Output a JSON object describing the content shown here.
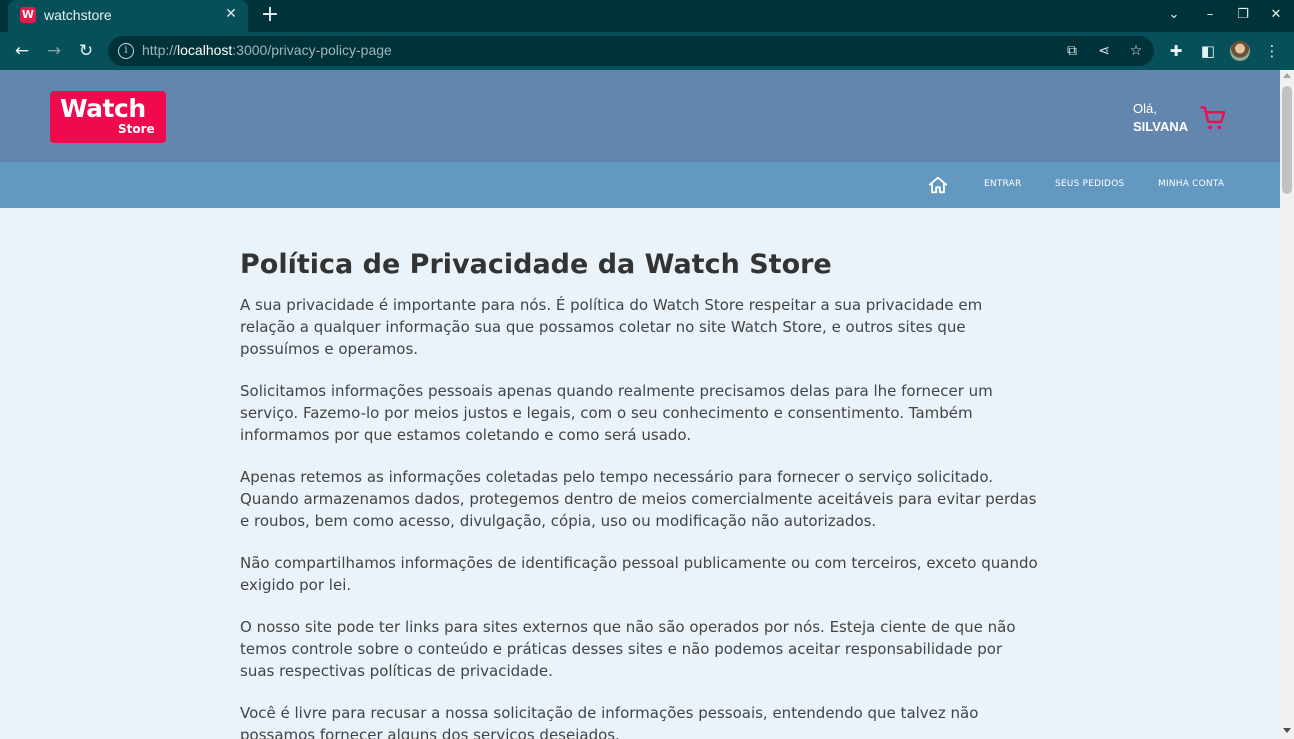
{
  "browser": {
    "tab_title": "watchstore",
    "favicon_letter": "W",
    "url_scheme": "http://",
    "url_host": "localhost",
    "url_path": ":3000/privacy-policy-page"
  },
  "header": {
    "logo_line1": "Watch",
    "logo_line2": "Store",
    "greeting": "Olá,",
    "user_name": "SILVANA",
    "brand_color": "#f1094e"
  },
  "nav": {
    "links": [
      "ENTRAR",
      "SEUS PEDIDOS",
      "MINHA CONTA"
    ]
  },
  "main": {
    "title": "Política de Privacidade da Watch Store",
    "paragraphs": [
      "A sua privacidade é importante para nós. É política do Watch Store respeitar a sua privacidade em relação a qualquer informação sua que possamos coletar no site Watch Store, e outros sites que possuímos e operamos.",
      "Solicitamos informações pessoais apenas quando realmente precisamos delas para lhe fornecer um serviço. Fazemo-lo por meios justos e legais, com o seu conhecimento e consentimento. Também informamos por que estamos coletando e como será usado.",
      "Apenas retemos as informações coletadas pelo tempo necessário para fornecer o serviço solicitado. Quando armazenamos dados, protegemos dentro de meios comercialmente aceitáveis para evitar perdas e roubos, bem como acesso, divulgação, cópia, uso ou modificação não autorizados.",
      "Não compartilhamos informações de identificação pessoal publicamente ou com terceiros, exceto quando exigido por lei.",
      "O nosso site pode ter links para sites externos que não são operados por nós. Esteja ciente de que não temos controle sobre o conteúdo e práticas desses sites e não podemos aceitar responsabilidade por suas respectivas políticas de privacidade.",
      "Você é livre para recusar a nossa solicitação de informações pessoais, entendendo que talvez não possamos fornecer alguns dos serviços desejados."
    ]
  }
}
